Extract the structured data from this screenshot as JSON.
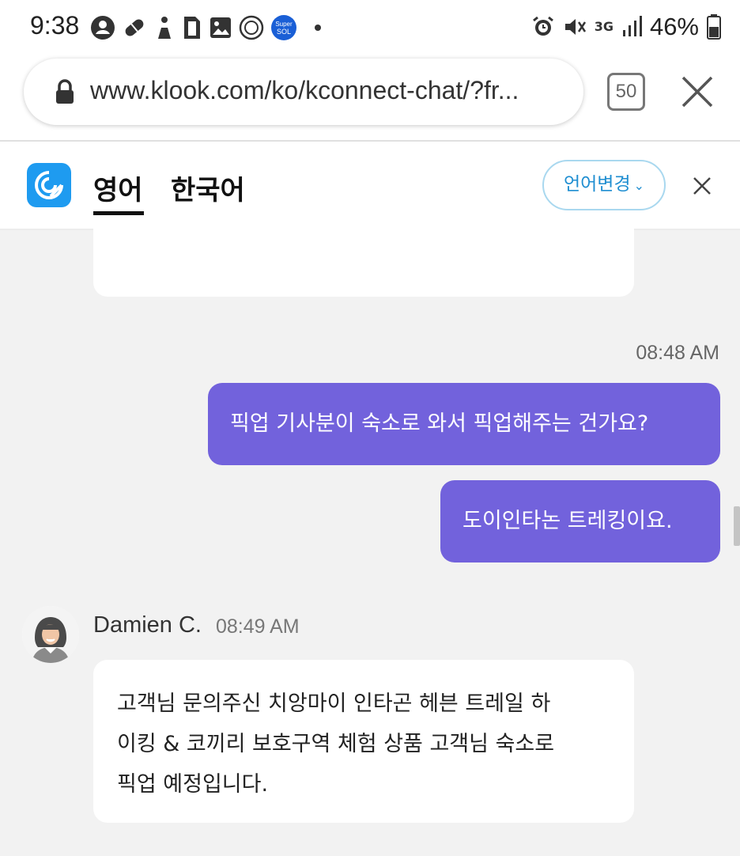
{
  "status_bar": {
    "time": "9:38",
    "left_icons": [
      "account-circle-icon",
      "pill-icon",
      "person-icon",
      "sim-card-icon",
      "image-icon",
      "badge-icon",
      "supersol-app-icon"
    ],
    "right_icons": [
      "alarm-icon",
      "mute-icon",
      "network-3g-icon",
      "signal-icon",
      "battery-icon"
    ],
    "network": "3G",
    "battery": "46%"
  },
  "browser": {
    "url": "www.klook.com/ko/kconnect-chat/?fr...",
    "tab_count": "50"
  },
  "translator": {
    "tabs": [
      {
        "label": "영어",
        "active": true
      },
      {
        "label": "한국어",
        "active": false
      }
    ],
    "change_language_label": "언어변경",
    "accent": "#1f8ed1"
  },
  "chat": {
    "outgoing_timestamp": "08:48 AM",
    "outgoing_messages": [
      "픽업 기사분이 숙소로 와서 픽업해주는 건가요?",
      "도이인타논 트레킹이요."
    ],
    "agent": {
      "name": "Damien C.",
      "time": "08:49 AM",
      "message_lines": [
        "고객님 문의주신 치앙마이 인타곤 헤븐 트레일 하",
        "이킹 & 코끼리 보호구역 체험 상품 고객님 숙소로",
        "픽업 예정입니다."
      ]
    },
    "outgoing_bubble_color": "#7262dc"
  }
}
